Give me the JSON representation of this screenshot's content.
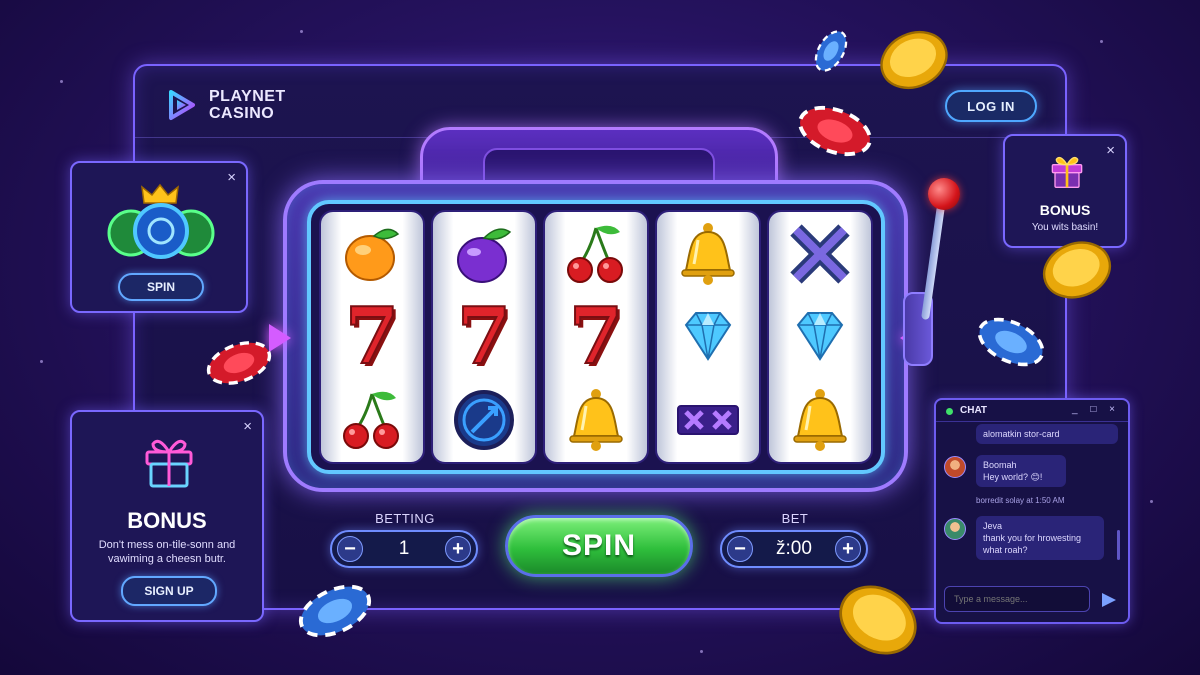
{
  "brand": {
    "name": "PLAYNET CASINO"
  },
  "header": {
    "login_label": "LOG IN"
  },
  "slot": {
    "reels": [
      [
        "orange",
        "seven",
        "cherry"
      ],
      [
        "plum",
        "seven",
        "wild-circle"
      ],
      [
        "cherry",
        "seven",
        "bell"
      ],
      [
        "bell",
        "diamond",
        "bar-x"
      ],
      [
        "x-symbol",
        "diamond",
        "bell"
      ]
    ],
    "seven_glyph": "7"
  },
  "controls": {
    "betting_label": "BETTING",
    "betting_value": "1",
    "bet_label": "BET",
    "bet_value": "ž:00",
    "minus": "−",
    "plus": "+",
    "spin_label": "SPIN"
  },
  "spin_card": {
    "button_label": "SPIN",
    "close": "×"
  },
  "bonus_card_left": {
    "title": "BONUS",
    "text_line1": "Don't mess on-tile-sonn and",
    "text_line2": "vawiming a cheesn butr.",
    "button_label": "SIGN UP",
    "close": "×"
  },
  "bonus_card_right": {
    "title": "BONUS",
    "text": "You wits basin!",
    "close": "×"
  },
  "chat": {
    "title": "CHAT",
    "controls": "_ □ ×",
    "top_message": "alomatkin stor-card",
    "messages": [
      {
        "user": "Boomah",
        "text": "Hey world? 😊!"
      },
      {
        "user": "Jeva",
        "text_line1": "thank you for hrowesting",
        "text_line2": "what roah?"
      }
    ],
    "meta": "borredit solay at 1:50 AM",
    "input_placeholder": "Type a message..."
  },
  "colors": {
    "accent": "#7a63ff",
    "spin_green": "#2fbf3c",
    "reel_border": "#62c8ff",
    "seven_red": "#e0242b"
  },
  "icons": [
    "playnet-logo-icon",
    "gift-icon",
    "crown-icon",
    "close-icon",
    "send-icon",
    "lever-icon"
  ]
}
